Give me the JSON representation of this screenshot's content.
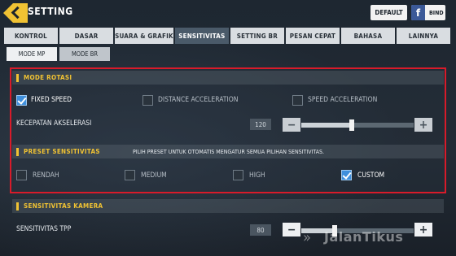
{
  "header": {
    "title": "SETTING",
    "default_label": "DEFAULT",
    "bind_label": "BIND"
  },
  "tabs": [
    {
      "label": "KONTROL"
    },
    {
      "label": "DASAR"
    },
    {
      "label": "SUARA & GRAFIK"
    },
    {
      "label": "SENSITIVITAS",
      "active": true
    },
    {
      "label": "SETTING BR"
    },
    {
      "label": "PESAN CEPAT"
    },
    {
      "label": "BAHASA"
    },
    {
      "label": "LAINNYA"
    }
  ],
  "subtabs": [
    {
      "label": "MODE MP"
    },
    {
      "label": "MODE BR",
      "active": true
    }
  ],
  "mode_rotasi": {
    "title": "MODE ROTASI",
    "options": [
      {
        "label": "FIXED SPEED",
        "checked": true
      },
      {
        "label": "DISTANCE ACCELERATION",
        "checked": false
      },
      {
        "label": "SPEED ACCELERATION",
        "checked": false
      }
    ],
    "kecepatan": {
      "label": "KECEPATAN AKSELERASI",
      "value": "120",
      "level": 0.45
    }
  },
  "preset": {
    "title": "PRESET SENSITIVITAS",
    "description": "PILIH PRESET UNTUK OTOMATIS MENGATUR SEMUA PILIHAN SENSITIVITAS.",
    "options": [
      {
        "label": "RENDAH",
        "checked": false
      },
      {
        "label": "MEDIUM",
        "checked": false
      },
      {
        "label": "HIGH",
        "checked": false
      },
      {
        "label": "CUSTOM",
        "checked": true
      }
    ]
  },
  "kamera": {
    "title": "SENSITIVITAS KAMERA",
    "tpp": {
      "label": "SENSITIVITAS TPP",
      "value": "80",
      "level": 0.3
    }
  },
  "steppers": {
    "minus": "−",
    "plus": "+"
  },
  "watermark": "JalanTikus",
  "colors": {
    "accent": "#f0c233",
    "highlight": "#d81b2a",
    "check": "#3f8fdc"
  }
}
